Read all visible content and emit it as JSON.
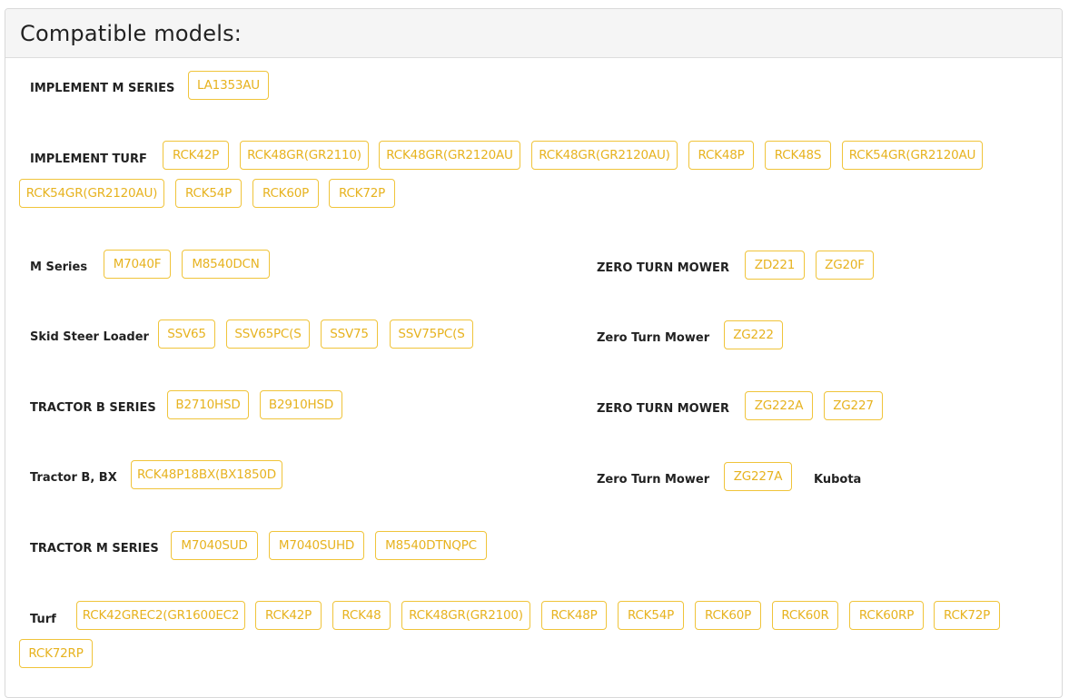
{
  "panel": {
    "title": "Compatible models:"
  },
  "groups": {
    "implement_m_series": {
      "label": "IMPLEMENT M SERIES",
      "models": [
        "LA1353AU"
      ]
    },
    "implement_turf": {
      "label": "IMPLEMENT TURF",
      "models": [
        "RCK42P",
        "RCK48GR(GR2110)",
        "RCK48GR(GR2120AU",
        "RCK48GR(GR2120AU)",
        "RCK48P",
        "RCK48S",
        "RCK54GR(GR2120AU",
        "RCK54GR(GR2120AU)",
        "RCK54P",
        "RCK60P",
        "RCK72P"
      ]
    },
    "m_series": {
      "label": "M Series",
      "models": [
        "M7040F",
        "M8540DCN"
      ]
    },
    "zero_turn_mower_1": {
      "label": "ZERO TURN MOWER",
      "models": [
        "ZD221",
        "ZG20F"
      ]
    },
    "skid_steer_loader": {
      "label": "Skid Steer Loader",
      "models": [
        "SSV65",
        "SSV65PC(S",
        "SSV75",
        "SSV75PC(S"
      ]
    },
    "zero_turn_mower_2": {
      "label": "Zero Turn Mower",
      "models": [
        "ZG222"
      ]
    },
    "tractor_b_series": {
      "label": "TRACTOR B SERIES",
      "models": [
        "B2710HSD",
        "B2910HSD"
      ]
    },
    "zero_turn_mower_3": {
      "label": "ZERO TURN MOWER",
      "models": [
        "ZG222A",
        "ZG227"
      ]
    },
    "tractor_b_bx": {
      "label": "Tractor B, BX",
      "models": [
        "RCK48P18BX(BX1850D"
      ]
    },
    "zero_turn_mower_4": {
      "label": "Zero Turn Mower",
      "models": [
        "ZG227A"
      ]
    },
    "kubota": {
      "label": "Kubota",
      "models": []
    },
    "tractor_m_series": {
      "label": "TRACTOR M SERIES",
      "models": [
        "M7040SUD",
        "M7040SUHD",
        "M8540DTNQPC"
      ]
    },
    "turf": {
      "label": "Turf",
      "models": [
        "RCK42GREC2(GR1600EC2",
        "RCK42P",
        "RCK48",
        "RCK48GR(GR2100)",
        "RCK48P",
        "RCK54P",
        "RCK60P",
        "RCK60R",
        "RCK60RP",
        "RCK72P",
        "RCK72RP"
      ]
    }
  },
  "colors": {
    "chip_border": "#f0c43a",
    "chip_text": "#e7b320",
    "header_bg": "#f5f5f5"
  }
}
